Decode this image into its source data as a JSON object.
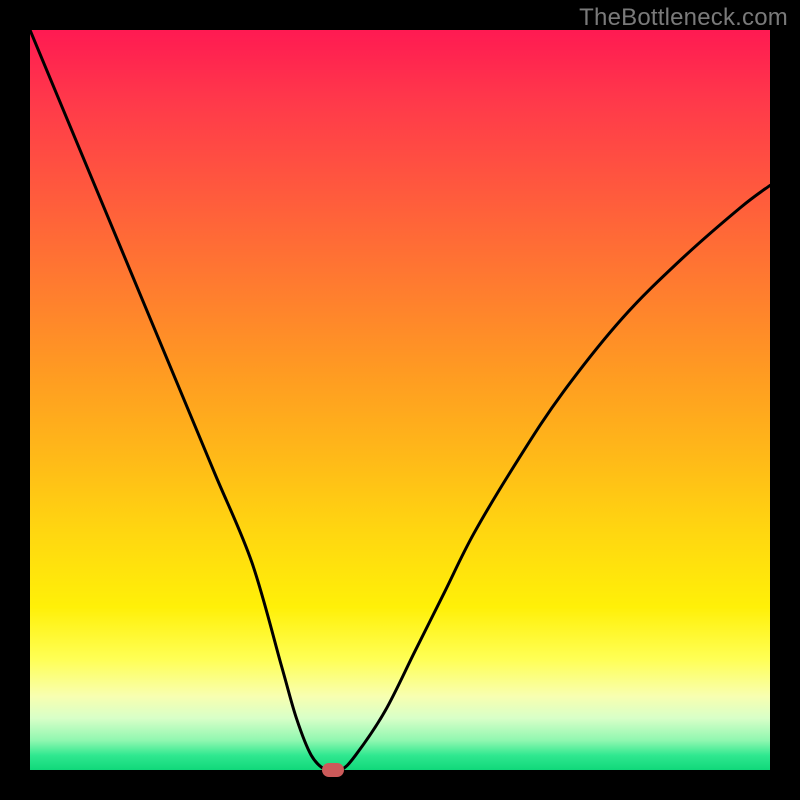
{
  "watermark": "TheBottleneck.com",
  "colors": {
    "frame": "#000000",
    "gradient_top": "#ff1a52",
    "gradient_bottom": "#10d87a",
    "curve": "#000000",
    "marker": "#cc5a5a"
  },
  "chart_data": {
    "type": "line",
    "title": "",
    "xlabel": "",
    "ylabel": "",
    "xlim": [
      0,
      100
    ],
    "ylim": [
      0,
      100
    ],
    "grid": false,
    "legend": false,
    "series": [
      {
        "name": "bottleneck-curve",
        "x": [
          0,
          5,
          10,
          15,
          20,
          25,
          30,
          34,
          36,
          38,
          40,
          42,
          44,
          48,
          52,
          56,
          60,
          66,
          72,
          80,
          88,
          96,
          100
        ],
        "values": [
          100,
          88,
          76,
          64,
          52,
          40,
          28,
          14,
          7,
          2,
          0,
          0,
          2,
          8,
          16,
          24,
          32,
          42,
          51,
          61,
          69,
          76,
          79
        ]
      }
    ],
    "annotations": [
      {
        "name": "minimum-marker",
        "x": 41,
        "y": 0
      }
    ]
  }
}
